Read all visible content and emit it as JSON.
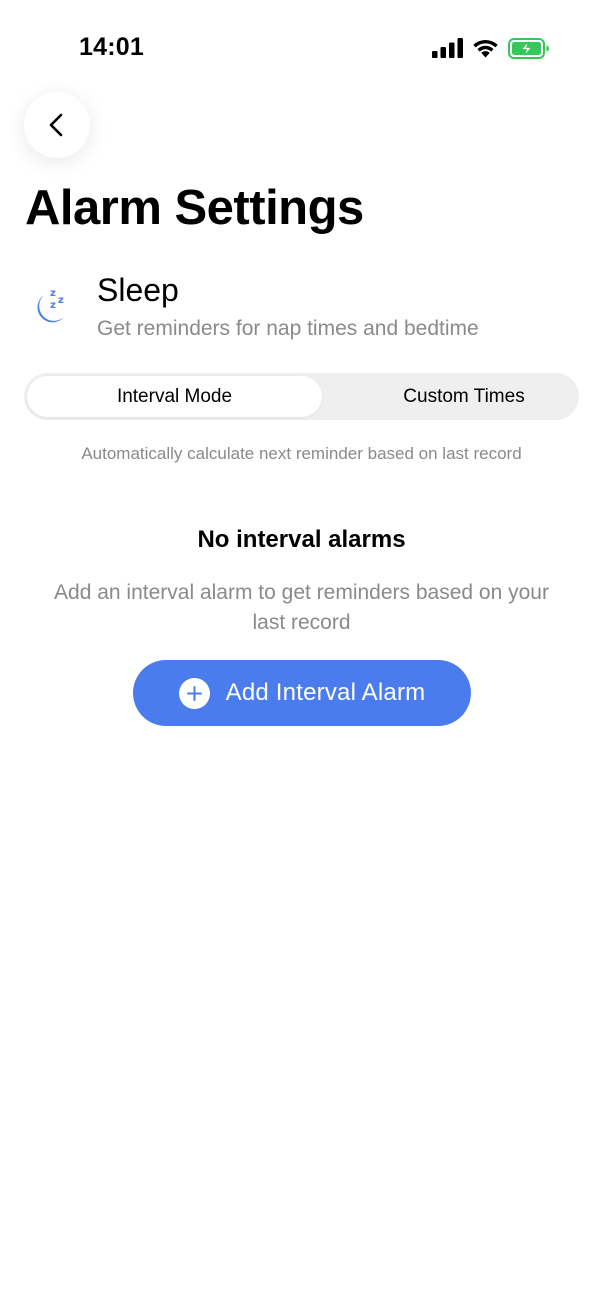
{
  "status_bar": {
    "time": "14:01",
    "icons": [
      "signal-icon",
      "wifi-icon",
      "battery-charging-icon"
    ],
    "battery_color": "#34c759"
  },
  "header": {
    "back_icon": "chevron-left-icon",
    "title": "Alarm Settings"
  },
  "category": {
    "icon": "sleep-moon-icon",
    "name": "Sleep",
    "description": "Get reminders for nap times and bedtime"
  },
  "mode_tabs": {
    "items": [
      {
        "label": "Interval Mode",
        "selected": true
      },
      {
        "label": "Custom Times",
        "selected": false
      }
    ],
    "hint": "Automatically calculate next reminder based on last record"
  },
  "empty_state": {
    "title": "No interval alarms",
    "description": "Add an interval alarm to get reminders based on your last record",
    "button_label": "Add Interval Alarm",
    "button_icon": "plus-circle-icon"
  },
  "colors": {
    "accent": "#4a7cee",
    "secondary_text": "#8a8a8e",
    "segment_bg": "#efeff0"
  }
}
